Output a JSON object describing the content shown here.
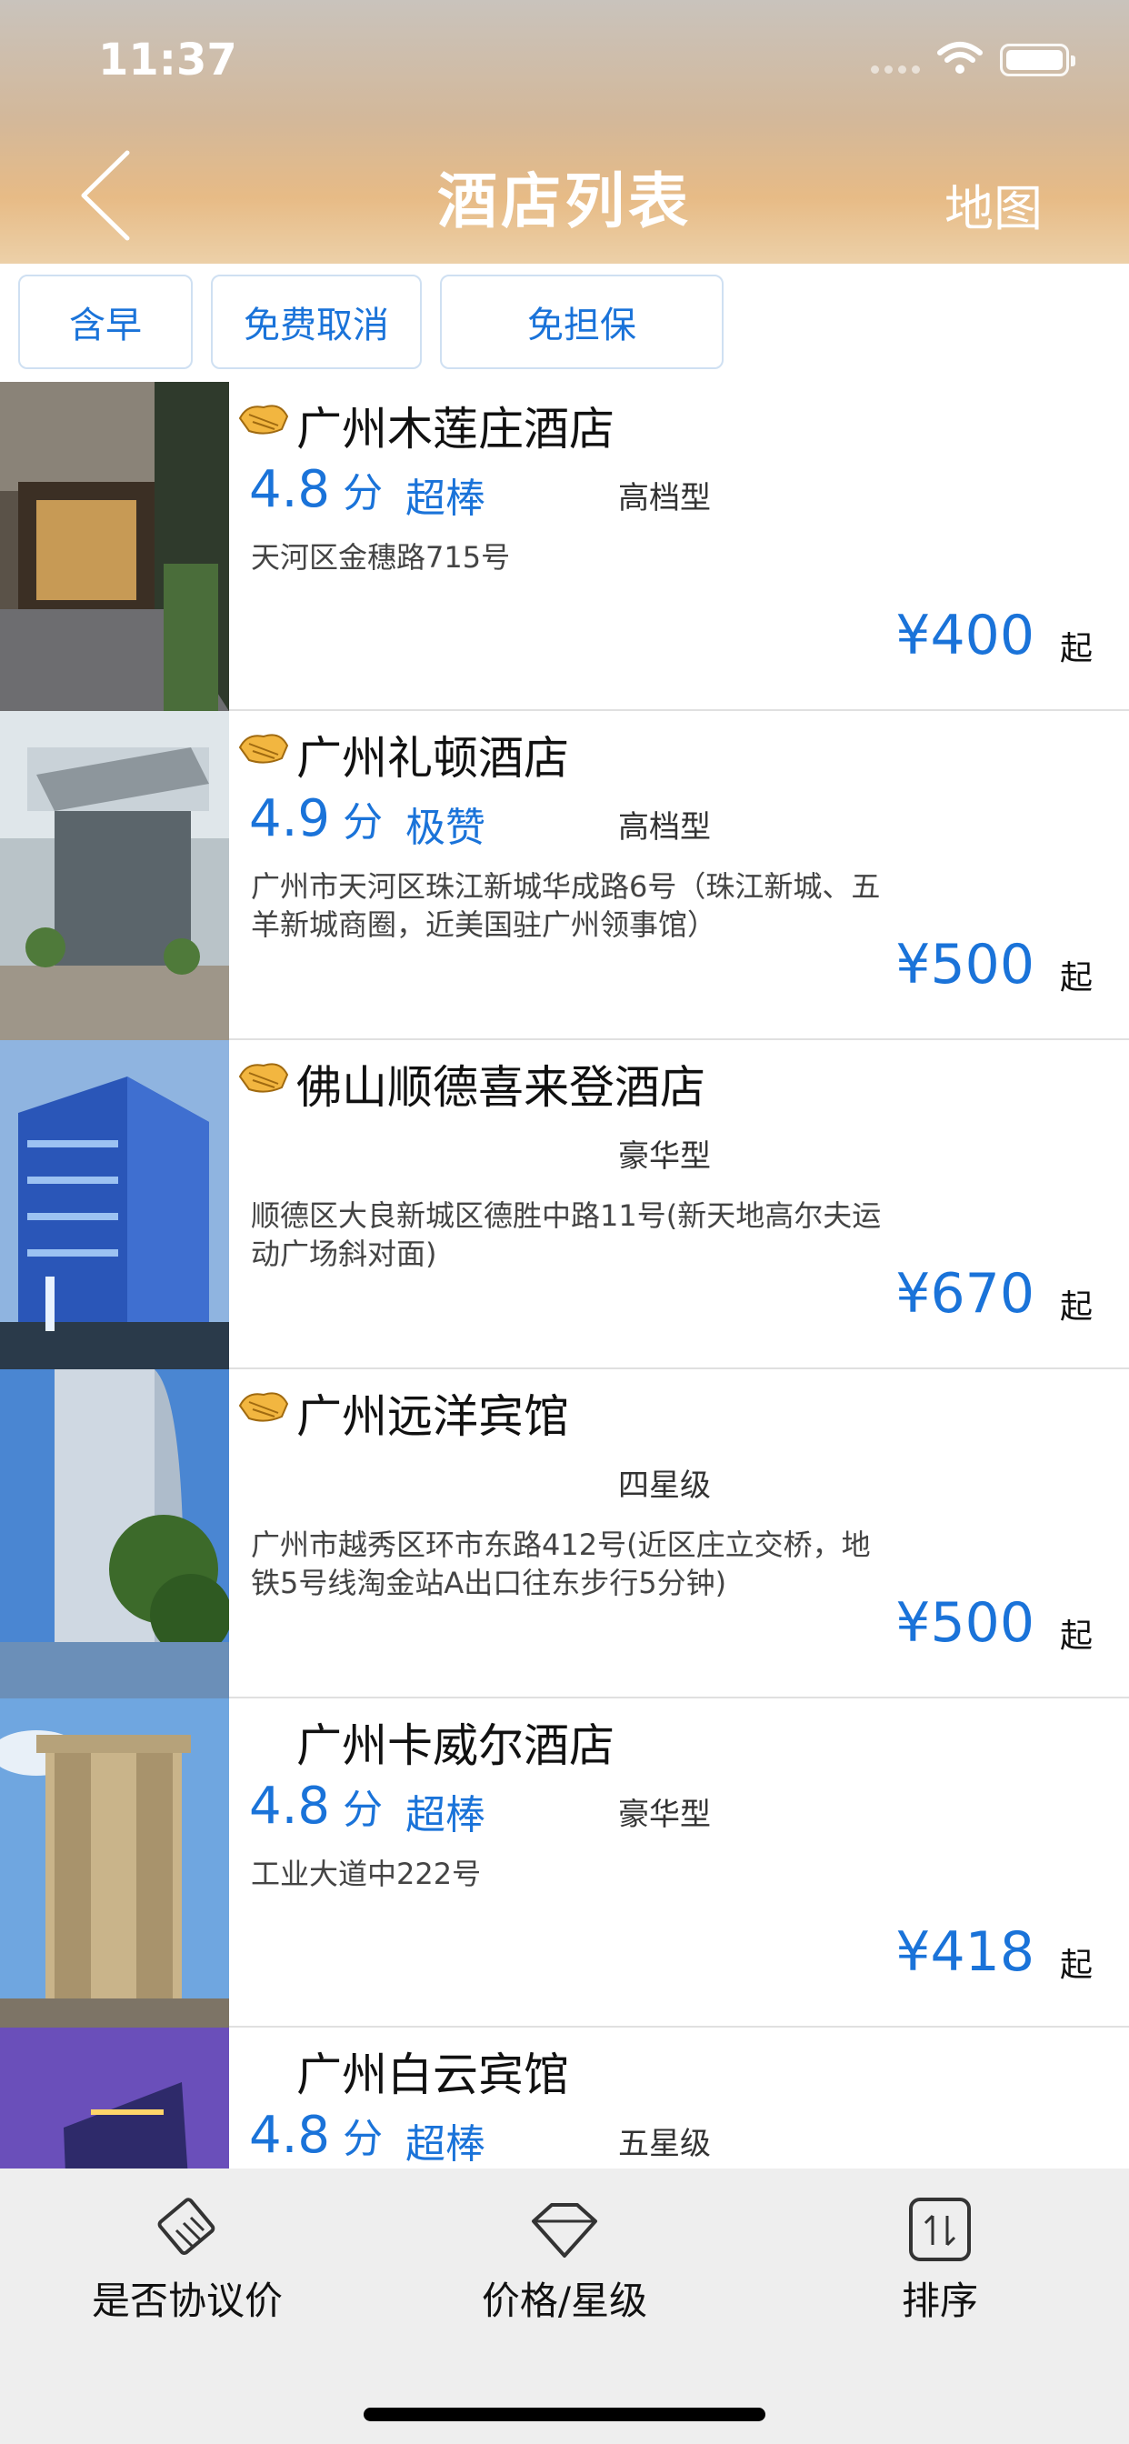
{
  "status_bar": {
    "time": "11:37"
  },
  "nav": {
    "title": "酒店列表",
    "map_label": "地图"
  },
  "filters": [
    {
      "label": "含早"
    },
    {
      "label": "免费取消"
    },
    {
      "label": "免担保"
    }
  ],
  "hotels": [
    {
      "name": "广州木莲庄酒店",
      "agreement_icon": true,
      "score": "4.8",
      "score_unit": "分",
      "rating_word": "超棒",
      "grade": "高档型",
      "address": "天河区金穗路715号",
      "price": "¥400",
      "price_suffix": "起"
    },
    {
      "name": "广州礼顿酒店",
      "agreement_icon": true,
      "score": "4.9",
      "score_unit": "分",
      "rating_word": "极赞",
      "grade": "高档型",
      "address": "广州市天河区珠江新城华成路6号（珠江新城、五羊新城商圈，近美国驻广州领事馆）",
      "price": "¥500",
      "price_suffix": "起"
    },
    {
      "name": "佛山顺德喜来登酒店",
      "agreement_icon": true,
      "score": "",
      "score_unit": "",
      "rating_word": "",
      "grade": "豪华型",
      "address": "顺德区大良新城区德胜中路11号(新天地高尔夫运动广场斜对面)",
      "price": "¥670",
      "price_suffix": "起"
    },
    {
      "name": "广州远洋宾馆",
      "agreement_icon": true,
      "score": "",
      "score_unit": "",
      "rating_word": "",
      "grade": "四星级",
      "address": "广州市越秀区环市东路412号(近区庄立交桥，地铁5号线淘金站A出口往东步行5分钟)",
      "price": "¥500",
      "price_suffix": "起"
    },
    {
      "name": "广州卡威尔酒店",
      "agreement_icon": false,
      "score": "4.8",
      "score_unit": "分",
      "rating_word": "超棒",
      "grade": "豪华型",
      "address": "工业大道中222号",
      "price": "¥418",
      "price_suffix": "起"
    },
    {
      "name": "广州白云宾馆",
      "agreement_icon": false,
      "score": "4.8",
      "score_unit": "分",
      "rating_word": "超棒",
      "grade": "五星级",
      "address": "",
      "price": "",
      "price_suffix": ""
    }
  ],
  "bottom_tabs": [
    {
      "label": "是否协议价",
      "icon": "handshake-icon"
    },
    {
      "label": "价格/星级",
      "icon": "diamond-icon"
    },
    {
      "label": "排序",
      "icon": "sort-icon"
    }
  ],
  "colors": {
    "accent": "#1a73d9",
    "header_warm": "#e7bb86"
  }
}
